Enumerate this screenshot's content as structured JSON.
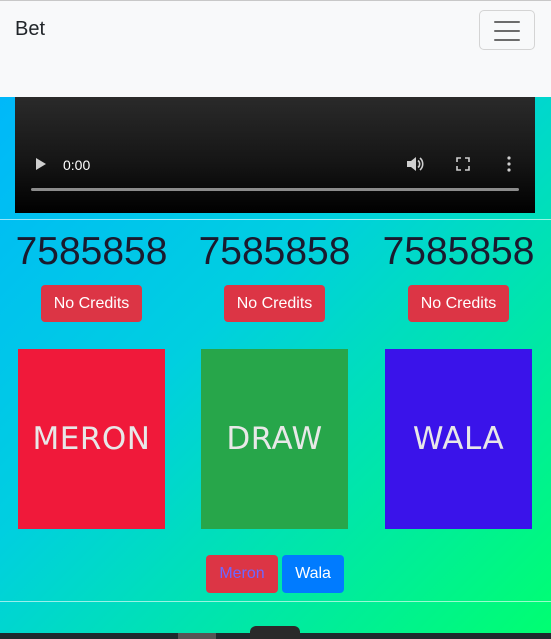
{
  "navbar": {
    "brand": "Bet",
    "toggler_icon": "hamburger-icon"
  },
  "video": {
    "time": "0:00",
    "progress": 0
  },
  "columns": [
    {
      "amount": "7585858",
      "button": "No Credits"
    },
    {
      "amount": "7585858",
      "button": "No Credits"
    },
    {
      "amount": "7585858",
      "button": "No Credits"
    }
  ],
  "cards": [
    {
      "label": "MERON",
      "color": "#f0193a"
    },
    {
      "label": "DRAW",
      "color": "#27a64a"
    },
    {
      "label": "WALA",
      "color": "#3a13ea"
    }
  ],
  "bet_buttons": {
    "meron": {
      "label": "Meron",
      "bg": "#dc3545",
      "text_color": "#6d67ff"
    },
    "wala": {
      "label": "Wala",
      "bg": "#007bff",
      "text_color": "#ffffff"
    }
  }
}
